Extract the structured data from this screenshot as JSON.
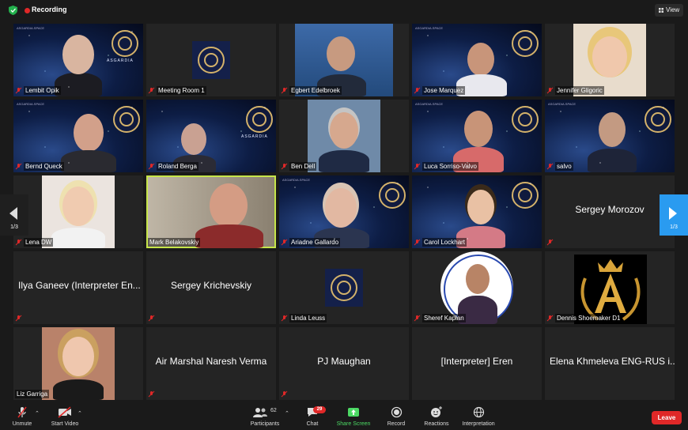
{
  "topbar": {
    "recording_label": "Recording",
    "view_label": "View"
  },
  "nav": {
    "left_page": "1/3",
    "right_page": "1/3"
  },
  "tiles": [
    {
      "name": "Lembit Opik",
      "bigname": "",
      "muted": true
    },
    {
      "name": "Meeting Room 1",
      "bigname": "",
      "muted": true
    },
    {
      "name": "Egbert Edelbroek",
      "bigname": "",
      "muted": true
    },
    {
      "name": "Jose Marquez",
      "bigname": "",
      "muted": true
    },
    {
      "name": "Jennifer Gligoric",
      "bigname": "",
      "muted": true
    },
    {
      "name": "Bernd Queck",
      "bigname": "",
      "muted": true
    },
    {
      "name": "Roland Berga",
      "bigname": "",
      "muted": true
    },
    {
      "name": "Ben Dell",
      "bigname": "",
      "muted": true
    },
    {
      "name": "Luca Sorriso-Valvo",
      "bigname": "",
      "muted": true
    },
    {
      "name": "salvo",
      "bigname": "",
      "muted": true
    },
    {
      "name": "Lena DW",
      "bigname": "",
      "muted": true
    },
    {
      "name": "Mark Belakovskiy",
      "bigname": "",
      "muted": false
    },
    {
      "name": "Ariadne Gallardo",
      "bigname": "",
      "muted": true
    },
    {
      "name": "Carol Lockhart",
      "bigname": "",
      "muted": true
    },
    {
      "name": "",
      "bigname": "Sergey Morozov",
      "muted": true
    },
    {
      "name": "",
      "bigname": "Ilya Ganeev (Interpreter En...",
      "muted": true
    },
    {
      "name": "",
      "bigname": "Sergey Krichevskiy",
      "muted": true
    },
    {
      "name": "Linda Leuss",
      "bigname": "",
      "muted": true
    },
    {
      "name": "Sheref Kaplan",
      "bigname": "",
      "muted": true
    },
    {
      "name": "Dennis Shoemaker D1",
      "bigname": "",
      "muted": true
    },
    {
      "name": "Liz Garriga",
      "bigname": "",
      "muted": false
    },
    {
      "name": "",
      "bigname": "Air Marshal Naresh Verma",
      "muted": true
    },
    {
      "name": "",
      "bigname": "PJ Maughan",
      "muted": true
    },
    {
      "name": "",
      "bigname": "[Interpreter] Eren",
      "muted": false
    },
    {
      "name": "",
      "bigname": "Elena Khmeleva ENG-RUS i...",
      "muted": false
    }
  ],
  "tile_texts": {
    "asgardia": "ASGARDIA",
    "asgardia_space": "ASGARDIA.SPACE",
    "space_nation": "THE SPACE NATION"
  },
  "toolbar": {
    "unmute": "Unmute",
    "start_video": "Start Video",
    "participants": "Participants",
    "participants_count": "62",
    "chat": "Chat",
    "chat_badge": "29",
    "share_screen": "Share Screen",
    "record": "Record",
    "reactions": "Reactions",
    "interpretation": "Interpretation",
    "leave": "Leave"
  },
  "colors": {
    "accent_green": "#4cd964",
    "leave_red": "#e02828",
    "active_border": "#c6e54a",
    "nav_blue": "#2a9bf0"
  }
}
